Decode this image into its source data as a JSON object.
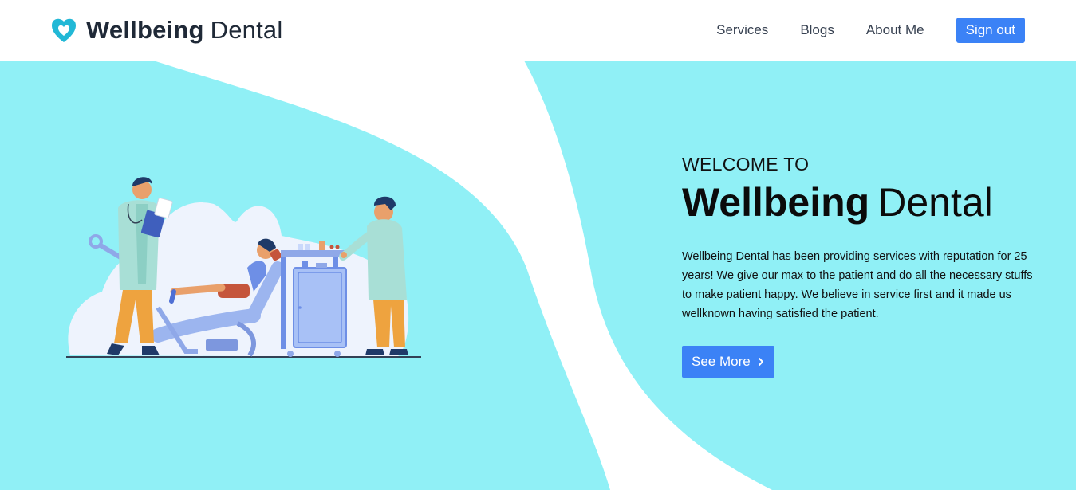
{
  "brand": {
    "name_strong": "Wellbeing",
    "name_light": "Dental",
    "logo_icon": "tooth-heart-icon",
    "logo_color": "#22b8d6"
  },
  "nav": {
    "links": [
      "Services",
      "Blogs",
      "About Me"
    ],
    "signout_label": "Sign out"
  },
  "hero": {
    "welcome": "WELCOME TO",
    "title_strong": "Wellbeing",
    "title_light": "Dental",
    "description": "Wellbeing Dental has been providing services with reputation for 25 years! We give our max to the patient and do all the necessary stuffs to make patient happy. We believe in service first and it made us wellknown having satisfied the patient.",
    "cta_label": "See More",
    "cta_icon": "chevron-right-icon"
  },
  "colors": {
    "accent": "#3b82f6",
    "hero_bg": "#90f0f6",
    "text_dark": "#1f2937"
  }
}
